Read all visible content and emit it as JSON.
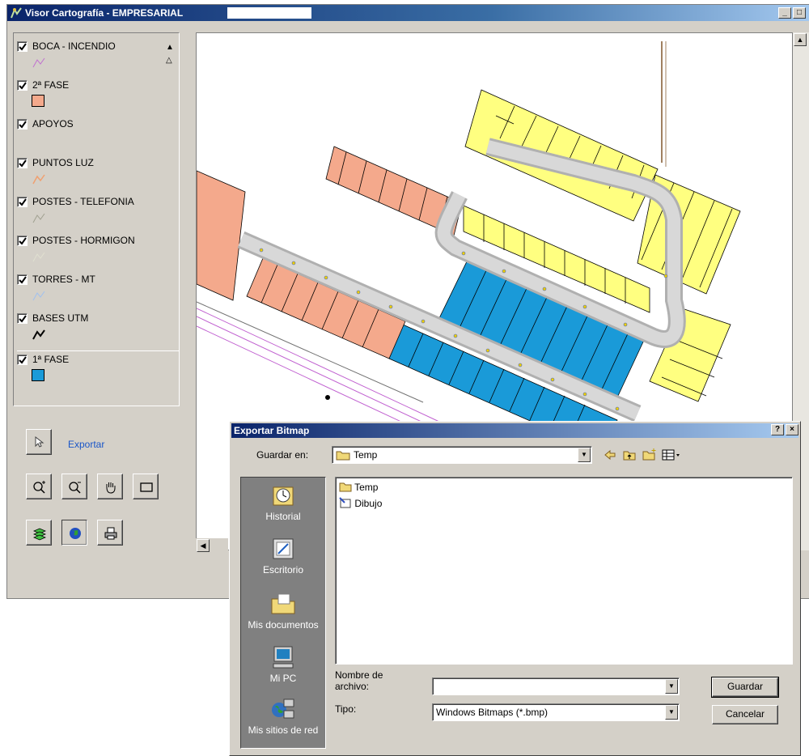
{
  "window": {
    "title": "Visor Cartografía - EMPRESARIAL",
    "caption_buttons": [
      "_",
      "□",
      "×"
    ]
  },
  "legend": {
    "layers": [
      {
        "label": "BOCA - INCENDIO",
        "checked": true,
        "symbol": "line",
        "color": "#c070d0"
      },
      {
        "label": "2ª FASE",
        "checked": true,
        "symbol": "fill",
        "color": "#f4a98c"
      },
      {
        "label": "APOYOS",
        "checked": true,
        "symbol": "none",
        "color": ""
      },
      {
        "label": "PUNTOS LUZ",
        "checked": true,
        "symbol": "line",
        "color": "#f0a070"
      },
      {
        "label": "POSTES - TELEFONIA",
        "checked": true,
        "symbol": "line",
        "color": "#a0a090"
      },
      {
        "label": "POSTES - HORMIGON",
        "checked": true,
        "symbol": "line",
        "color": "#e0e0d0"
      },
      {
        "label": "TORRES - MT",
        "checked": true,
        "symbol": "line",
        "color": "#a0c0f0"
      },
      {
        "label": "BASES UTM",
        "checked": true,
        "symbol": "line",
        "color": "#000000"
      },
      {
        "label": "1ª FASE",
        "checked": true,
        "symbol": "fill",
        "color": "#1a9ad8"
      }
    ]
  },
  "tools": {
    "exportar_label": "Exportar"
  },
  "colors": {
    "parcel_yellow": "#ffff80",
    "parcel_salmon": "#f4a98c",
    "parcel_blue": "#1a9ad8",
    "road": "#d8d8d8"
  },
  "dialog": {
    "title": "Exportar Bitmap",
    "help_button": "?",
    "close_button": "×",
    "save_in_label": "Guardar en:",
    "save_in_value": "Temp",
    "places": [
      "Historial",
      "Escritorio",
      "Mis documentos",
      "Mi PC",
      "Mis sitios de red"
    ],
    "files": [
      {
        "name": "Temp",
        "icon": "folder-icon"
      },
      {
        "name": "Dibujo",
        "icon": "program-icon"
      }
    ],
    "filename_label_line1": "Nombre de",
    "filename_label_line2": "archivo:",
    "filename_value": "",
    "type_label": "Tipo:",
    "type_value": "Windows Bitmaps (*.bmp)",
    "save_button": "Guardar",
    "cancel_button": "Cancelar"
  }
}
